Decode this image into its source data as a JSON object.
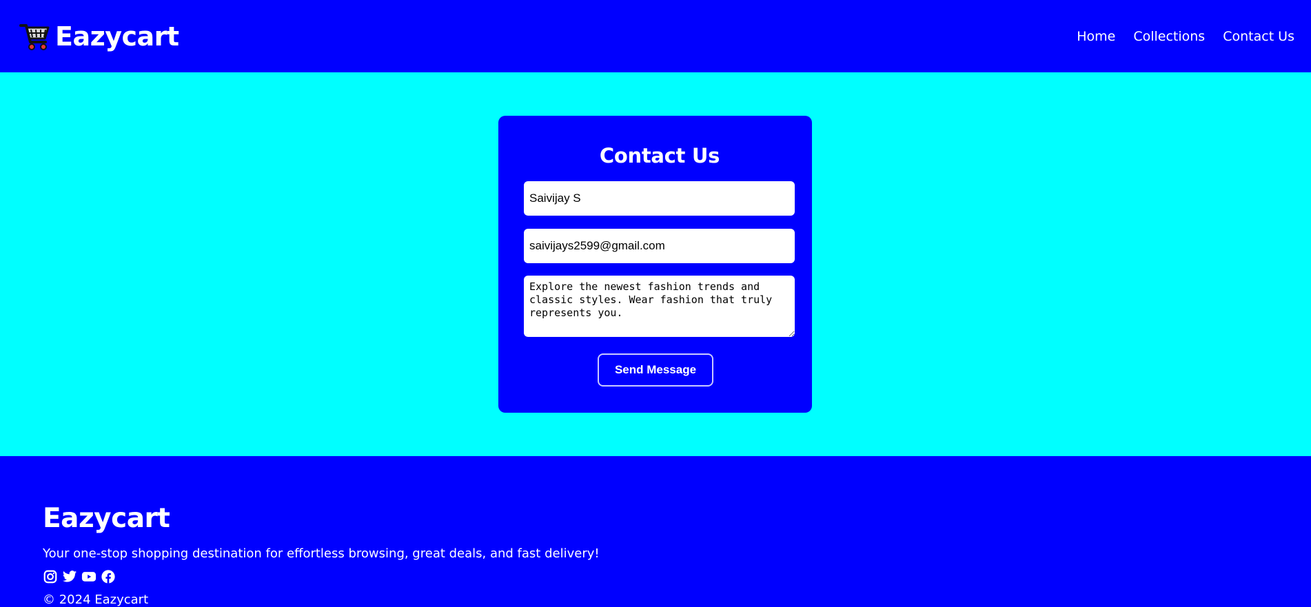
{
  "colors": {
    "header_bg": "#0000ff",
    "hero_bg": "#00ffff",
    "card_bg": "#0000ff",
    "footer_bg": "#0000ff",
    "text_light": "#ffffff"
  },
  "header": {
    "brand_icon": "shopping-cart-icon",
    "brand_name": "Eazycart",
    "nav": [
      {
        "label": "Home"
      },
      {
        "label": "Collections"
      },
      {
        "label": "Contact Us"
      }
    ]
  },
  "contact_form": {
    "title": "Contact Us",
    "name_value": "Saivijay S",
    "email_value": "saivijays2599@gmail.com",
    "message_value": "Explore the newest fashion trends and classic styles. Wear fashion that truly represents you.",
    "submit_label": "Send Message"
  },
  "footer": {
    "brand_name": "Eazycart",
    "tagline": "Your one-stop shopping destination for effortless browsing, great deals, and fast delivery!",
    "social_icons": [
      "instagram-icon",
      "twitter-icon",
      "youtube-icon",
      "facebook-icon"
    ],
    "copyright": "© 2024 Eazycart"
  }
}
